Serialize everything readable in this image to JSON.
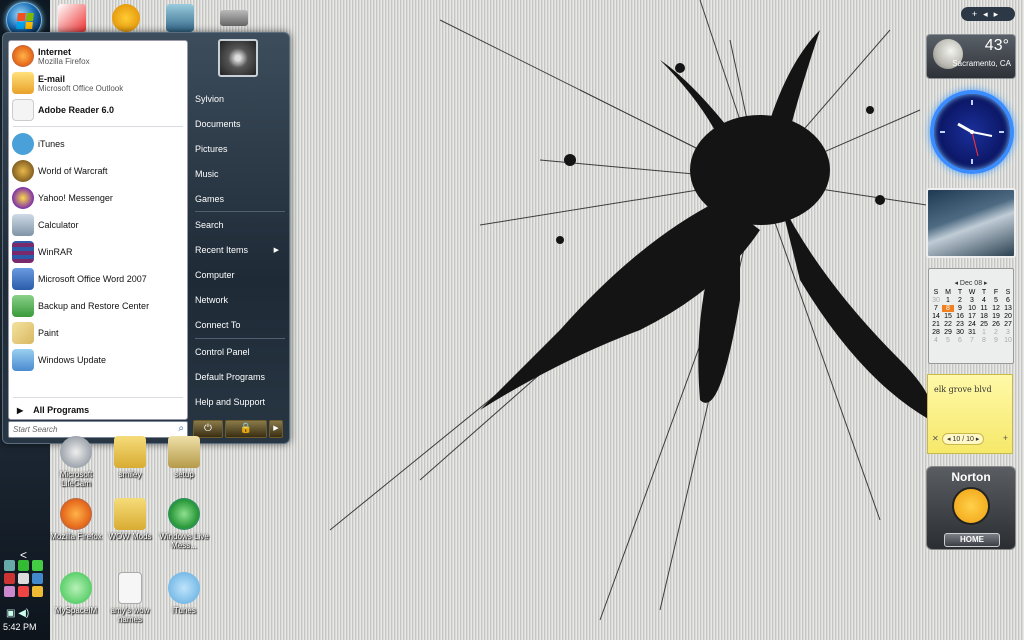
{
  "taskbar": {
    "clock": "5:42 PM",
    "chevron": "<"
  },
  "start_menu": {
    "pinned": [
      {
        "title": "Internet",
        "subtitle": "Mozilla Firefox",
        "icon": "firefox-icon",
        "color": "#e66a1c"
      },
      {
        "title": "E-mail",
        "subtitle": "Microsoft Office Outlook",
        "icon": "outlook-icon",
        "color": "#e8b12a"
      },
      {
        "title": "Adobe Reader 6.0",
        "subtitle": "",
        "icon": "pdf-icon",
        "color": "#eeeeee"
      }
    ],
    "recent": [
      {
        "title": "iTunes",
        "icon": "itunes-icon",
        "color": "#4aa0d8"
      },
      {
        "title": "World of Warcraft",
        "icon": "wow-icon",
        "color": "#5a3a12"
      },
      {
        "title": "Yahoo! Messenger",
        "icon": "yahoo-icon",
        "color": "#7b2fa8"
      },
      {
        "title": "Calculator",
        "icon": "calculator-icon",
        "color": "#9fb4c8"
      },
      {
        "title": "WinRAR",
        "icon": "winrar-icon",
        "color": "#7a2a6a"
      },
      {
        "title": "Microsoft Office Word 2007",
        "icon": "word-icon",
        "color": "#2a5caa"
      },
      {
        "title": "Backup and Restore Center",
        "icon": "backup-icon",
        "color": "#3a9a3a"
      },
      {
        "title": "Paint",
        "icon": "paint-icon",
        "color": "#d8b860"
      },
      {
        "title": "Windows Update",
        "icon": "windows-update-icon",
        "color": "#4a8ad0"
      }
    ],
    "all_programs": "All Programs",
    "search_placeholder": "Start Search",
    "right_items": [
      "Sylvion",
      "Documents",
      "Pictures",
      "Music",
      "Games",
      "Search",
      "Recent Items",
      "Computer",
      "Network",
      "Connect To",
      "Control Panel",
      "Default Programs",
      "Help and Support"
    ]
  },
  "desktop_icons": [
    {
      "label": "Microsoft LifeCam",
      "color": "#9aa4ae"
    },
    {
      "label": "smiley",
      "color": "#e8c24a"
    },
    {
      "label": "setup",
      "color": "#d9c27a"
    },
    {
      "label": "Mozilla Firefox",
      "color": "#e66a1c"
    },
    {
      "label": "WOW Mods",
      "color": "#e6c95a"
    },
    {
      "label": "Windows Live Mess...",
      "color": "#3ab050"
    },
    {
      "label": "MySpaceIM",
      "color": "#34c24a"
    },
    {
      "label": "amy's wow names",
      "color": "#f0f0f0"
    },
    {
      "label": "iTunes",
      "color": "#5aa8e0"
    }
  ],
  "gadgets": {
    "weather": {
      "temp": "43°",
      "location": "Sacramento, CA"
    },
    "calendar": {
      "month": "Dec 08",
      "weekdays": [
        "S",
        "M",
        "T",
        "W",
        "T",
        "F",
        "S"
      ],
      "days": [
        "30",
        "1",
        "2",
        "3",
        "4",
        "5",
        "6",
        "7",
        "8",
        "9",
        "10",
        "11",
        "12",
        "13",
        "14",
        "15",
        "16",
        "17",
        "18",
        "19",
        "20",
        "21",
        "22",
        "23",
        "24",
        "25",
        "26",
        "27",
        "28",
        "29",
        "30",
        "31",
        "1",
        "2",
        "3",
        "4",
        "5",
        "6",
        "7",
        "8",
        "9",
        "10"
      ],
      "today": "8"
    },
    "note": {
      "text": "elk grove blvd",
      "page": "10 / 10"
    },
    "norton": {
      "brand": "Norton",
      "button": "HOME"
    }
  }
}
